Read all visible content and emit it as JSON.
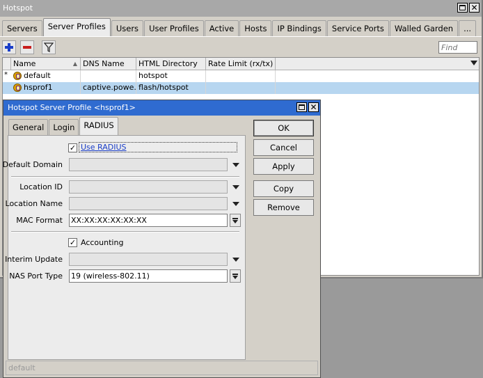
{
  "main_window": {
    "title": "Hotspot",
    "tabs": [
      "Servers",
      "Server Profiles",
      "Users",
      "User Profiles",
      "Active",
      "Hosts",
      "IP Bindings",
      "Service Ports",
      "Walled Garden",
      "..."
    ],
    "find_placeholder": "Find",
    "columns": [
      "Name",
      "DNS Name",
      "HTML Directory",
      "Rate Limit (rx/tx)"
    ],
    "rows": [
      {
        "flag": "*",
        "name": "default",
        "dns": "",
        "html_dir": "hotspot",
        "rate": ""
      },
      {
        "flag": "",
        "name": "hsprof1",
        "dns": "captive.powe...",
        "html_dir": "flash/hotspot",
        "rate": ""
      }
    ]
  },
  "dialog": {
    "title": "Hotspot Server Profile <hsprof1>",
    "tabs": [
      "General",
      "Login",
      "RADIUS"
    ],
    "use_radius_label": "Use RADIUS",
    "default_domain_label": "Default Domain",
    "default_domain_value": "",
    "location_id_label": "Location ID",
    "location_id_value": "",
    "location_name_label": "Location Name",
    "location_name_value": "",
    "mac_format_label": "MAC Format",
    "mac_format_value": "XX:XX:XX:XX:XX:XX",
    "accounting_label": "Accounting",
    "interim_update_label": "Interim Update",
    "interim_update_value": "",
    "nas_port_type_label": "NAS Port Type",
    "nas_port_type_value": "19 (wireless-802.11)",
    "buttons": {
      "ok": "OK",
      "cancel": "Cancel",
      "apply": "Apply",
      "copy": "Copy",
      "remove": "Remove"
    },
    "status_text": "default"
  },
  "colors": {
    "dialog_title_bg": "#2f6bd0",
    "selected_row": "#b7d6f0",
    "add_icon": "#1a3ec8",
    "remove_icon": "#c81e1e"
  },
  "icons": [
    "maximize-icon",
    "close-icon",
    "plus-icon",
    "minus-icon",
    "filter-icon",
    "sort-arrow-icon",
    "dropdown-arrow-icon",
    "hotspot-profile-icon",
    "checkmark-icon"
  ]
}
